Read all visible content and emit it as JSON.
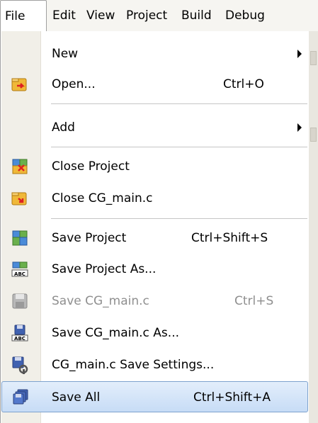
{
  "menubar": {
    "items": [
      "File",
      "Edit",
      "View",
      "Project",
      "Build",
      "Debug"
    ]
  },
  "file_menu": {
    "items": [
      {
        "label": "New",
        "submenu": true
      },
      {
        "label": "Open...",
        "shortcut": "Ctrl+O",
        "icon": "open-folder-icon"
      },
      {
        "label": "Add",
        "submenu": true
      },
      {
        "label": "Close Project",
        "icon": "close-project-icon"
      },
      {
        "label": "Close CG_main.c",
        "icon": "close-file-icon"
      },
      {
        "label": "Save Project",
        "shortcut": "Ctrl+Shift+S",
        "icon": "save-project-icon"
      },
      {
        "label": "Save Project As...",
        "icon": "save-project-as-icon"
      },
      {
        "label": "Save CG_main.c",
        "shortcut": "Ctrl+S",
        "icon": "save-disk-icon",
        "disabled": true
      },
      {
        "label": "Save CG_main.c As...",
        "icon": "save-as-disk-icon"
      },
      {
        "label": "CG_main.c Save Settings...",
        "icon": "save-settings-icon"
      },
      {
        "label": "Save All",
        "shortcut": "Ctrl+Shift+A",
        "icon": "save-all-icon",
        "highlighted": true
      }
    ]
  },
  "colors": {
    "highlight_border": "#7da2ce",
    "highlight_fill": "#c7dcf6",
    "gutter": "#f1efe8",
    "disabled_text": "#8f8f8f"
  }
}
